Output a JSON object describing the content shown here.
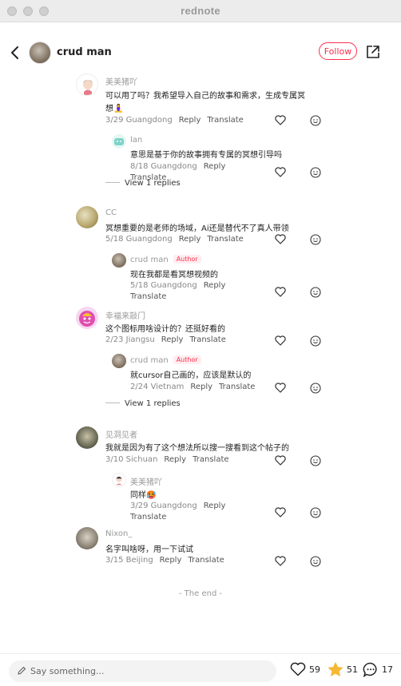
{
  "window": {
    "title": "rednote"
  },
  "header": {
    "username": "crud man",
    "follow_label": "Follow"
  },
  "comments": [
    {
      "user": "美美猪吖",
      "text": "可以用了吗？我希望导入自己的故事和需求，生成专属冥",
      "text2": "想🧘‍♀️",
      "date": "3/29 Guangdong",
      "reply": "Reply",
      "translate": "Translate",
      "replies": [
        {
          "user": "lan",
          "text": "意思是基于你的故事拥有专属的冥想引导吗",
          "date": "8/18 Guangdong",
          "reply": "Reply",
          "translate": "Translate"
        }
      ],
      "view_replies": "View 1 replies"
    },
    {
      "user": "CC",
      "text": "冥想重要的是老师的场域，Ai还是替代不了真人带领",
      "date": "5/18 Guangdong",
      "reply": "Reply",
      "translate": "Translate",
      "replies": [
        {
          "user": "crud man",
          "tag": "Author",
          "text": "现在我都是看冥想视频的",
          "date": "5/18 Guangdong",
          "reply": "Reply",
          "translate": "Translate"
        }
      ]
    },
    {
      "user": "幸福来敲门",
      "text": "这个图标用啥设计的？还挺好看的",
      "date": "2/23 Jiangsu",
      "reply": "Reply",
      "translate": "Translate",
      "replies": [
        {
          "user": "crud man",
          "tag": "Author",
          "text": "就cursor自己画的，应该是默认的",
          "date": "2/24 Vietnam",
          "reply": "Reply",
          "translate": "Translate"
        }
      ],
      "view_replies": "View 1 replies"
    },
    {
      "user": "见洞见者",
      "text": "我就是因为有了这个想法所以搜一搜看到这个帖子的",
      "date": "3/10 Sichuan",
      "reply": "Reply",
      "translate": "Translate",
      "replies": [
        {
          "user": "美美猪吖",
          "text": "同样🥵",
          "date": "3/29 Guangdong",
          "reply": "Reply",
          "translate": "Translate"
        }
      ]
    },
    {
      "user": "Nixon_",
      "text": "名字叫啥呀，用一下试试",
      "date": "3/15 Beijing",
      "reply": "Reply",
      "translate": "Translate"
    }
  ],
  "end_text": "- The end -",
  "bottom": {
    "placeholder": "Say something...",
    "likes": "59",
    "stars": "51",
    "comments": "17"
  },
  "colors": {
    "accent": "#ff2e4d",
    "star": "#f7b731"
  }
}
